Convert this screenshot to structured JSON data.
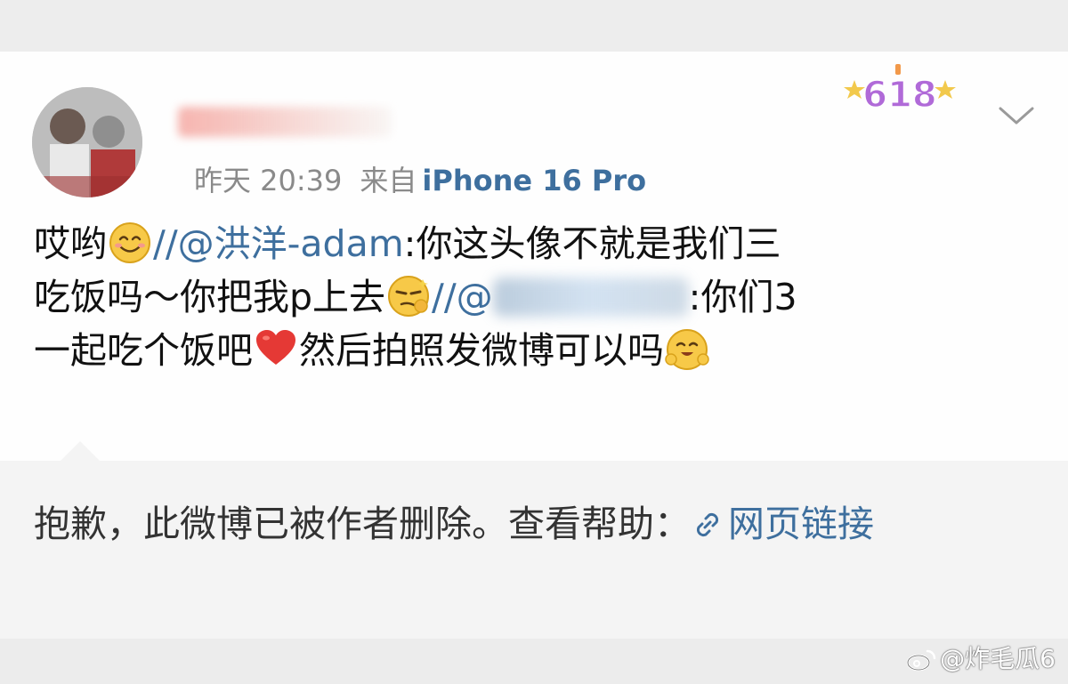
{
  "post": {
    "timestamp": "昨天 20:39",
    "source_prefix": "来自",
    "device": "iPhone 16 Pro",
    "badge_text": "618",
    "content": {
      "line1_prefix": "哎哟",
      "line1_sep": "//",
      "mention1": "@洪洋-adam",
      "line1_rest": ":你这头像不就是我们三",
      "line2_text": "吃饭吗～你把我p上去",
      "line2_sep": "//",
      "mention2_prefix": "@",
      "line2_rest": ":你们3",
      "line3_a": "一起吃个饭吧",
      "line3_b": "然后拍照发微博可以吗"
    }
  },
  "deleted_notice": {
    "text": "抱歉，此微博已被作者删除。查看帮助：",
    "link_label": "网页链接"
  },
  "watermark": {
    "text": "@炸毛瓜6"
  },
  "colors": {
    "link": "#3e6f9e",
    "meta_gray": "#8a8a8a",
    "page_bg": "#ececec",
    "card_bg": "#fefefe"
  },
  "icons": [
    "avatar",
    "chevron-down-icon",
    "smile-emoji",
    "smirk-emoji",
    "heart-emoji",
    "blush-emoji",
    "link-icon",
    "weibo-logo-icon"
  ]
}
